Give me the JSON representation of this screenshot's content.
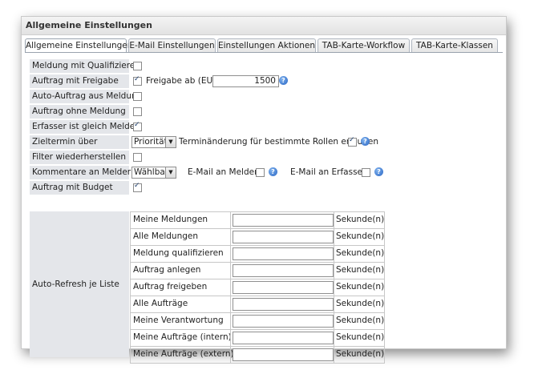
{
  "panel_title": "Allgemeine Einstellungen",
  "tabs": [
    "Allgemeine Einstellungen",
    "E-Mail Einstellungen",
    "Einstellungen Aktionen",
    "TAB-Karte-Workflow",
    "TAB-Karte-Klassen"
  ],
  "settings": {
    "meldung_qualifizieren": {
      "label": "Meldung mit Qualifizieren",
      "checked": false
    },
    "auftrag_freigabe": {
      "label": "Auftrag mit Freigabe",
      "checked": true,
      "freigabe_label": "Freigabe ab (EUR)",
      "freigabe_value": "1500"
    },
    "auto_auftrag": {
      "label": "Auto-Auftrag aus Meldung",
      "checked": false
    },
    "auftrag_ohne_meldung": {
      "label": "Auftrag ohne Meldung",
      "checked": false
    },
    "erfasser_melder": {
      "label": "Erfasser ist gleich Melder",
      "checked": true
    },
    "zieltermin": {
      "label": "Zieltermin über",
      "select_value": "Priorität",
      "extra_label": "Terminänderung für bestimmte Rollen erlauben",
      "checked": true
    },
    "filter": {
      "label": "Filter wiederherstellen",
      "checked": false
    },
    "kommentare": {
      "label": "Kommentare an Melder",
      "select_value": "Wählbar",
      "email_melder_label": "E-Mail an Melder",
      "email_erfasser_label": "E-Mail an Erfasser"
    },
    "budget": {
      "label": "Auftrag mit Budget",
      "checked": true
    }
  },
  "auto_refresh": {
    "label": "Auto-Refresh je Liste",
    "unit": "Sekunde(n)",
    "lists": [
      "Meine Meldungen",
      "Alle Meldungen",
      "Meldung qualifizieren",
      "Auftrag anlegen",
      "Auftrag freigeben",
      "Alle Aufträge",
      "Meine Verantwortung",
      "Meine Aufträge (intern)",
      "Meine Aufträge (extern)"
    ]
  },
  "icons": {
    "help": "help-icon",
    "dropdown": "chevron-down-icon"
  }
}
